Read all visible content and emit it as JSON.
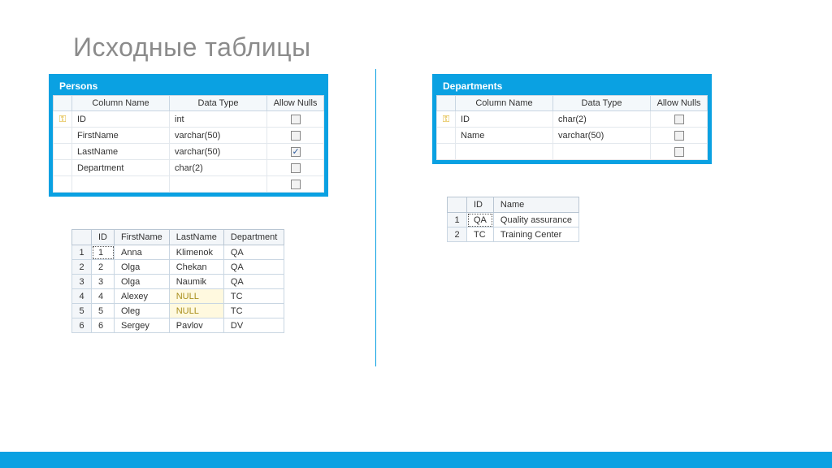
{
  "title": "Исходные таблицы",
  "schema_headers": {
    "colname": "Column Name",
    "datatype": "Data Type",
    "allownulls": "Allow Nulls"
  },
  "persons_schema": {
    "title": "Persons",
    "rows": [
      {
        "key": true,
        "name": "ID",
        "type": "int",
        "nulls": false
      },
      {
        "key": false,
        "name": "FirstName",
        "type": "varchar(50)",
        "nulls": false
      },
      {
        "key": false,
        "name": "LastName",
        "type": "varchar(50)",
        "nulls": true
      },
      {
        "key": false,
        "name": "Department",
        "type": "char(2)",
        "nulls": false
      },
      {
        "key": false,
        "name": "",
        "type": "",
        "nulls": false
      }
    ]
  },
  "departments_schema": {
    "title": "Departments",
    "rows": [
      {
        "key": true,
        "name": "ID",
        "type": "char(2)",
        "nulls": false
      },
      {
        "key": false,
        "name": "Name",
        "type": "varchar(50)",
        "nulls": false
      },
      {
        "key": false,
        "name": "",
        "type": "",
        "nulls": false
      }
    ]
  },
  "persons_data": {
    "headers": [
      "",
      "ID",
      "FirstName",
      "LastName",
      "Department"
    ],
    "rows": [
      {
        "n": "1",
        "id": "1",
        "first": "Anna",
        "last": "Klimenok",
        "dept": "QA",
        "last_null": false,
        "sel": true
      },
      {
        "n": "2",
        "id": "2",
        "first": "Olga",
        "last": "Chekan",
        "dept": "QA",
        "last_null": false,
        "sel": false
      },
      {
        "n": "3",
        "id": "3",
        "first": "Olga",
        "last": "Naumik",
        "dept": "QA",
        "last_null": false,
        "sel": false
      },
      {
        "n": "4",
        "id": "4",
        "first": "Alexey",
        "last": "NULL",
        "dept": "TC",
        "last_null": true,
        "sel": false
      },
      {
        "n": "5",
        "id": "5",
        "first": "Oleg",
        "last": "NULL",
        "dept": "TC",
        "last_null": true,
        "sel": false
      },
      {
        "n": "6",
        "id": "6",
        "first": "Sergey",
        "last": "Pavlov",
        "dept": "DV",
        "last_null": false,
        "sel": false
      }
    ]
  },
  "departments_data": {
    "headers": [
      "",
      "ID",
      "Name"
    ],
    "rows": [
      {
        "n": "1",
        "id": "QA",
        "name": "Quality assurance",
        "sel": true
      },
      {
        "n": "2",
        "id": "TC",
        "name": "Training Center",
        "sel": false
      }
    ]
  }
}
